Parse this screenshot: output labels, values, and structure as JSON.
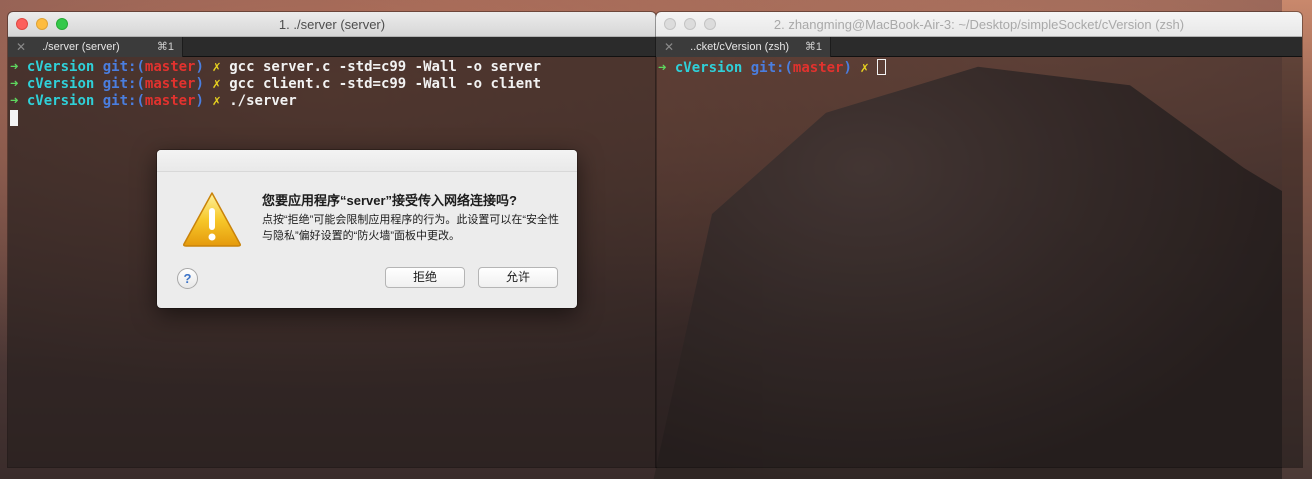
{
  "left_window": {
    "title": "1. ./server (server)",
    "tab_label": "./server (server)",
    "tab_shortcut": "⌘1",
    "lines": [
      {
        "arrow": "➜",
        "dir": "cVersion",
        "git": "git:",
        "open": "(",
        "branch": "master",
        "close": ")",
        "x": "✗",
        "cmd": "gcc server.c -std=c99 -Wall -o server"
      },
      {
        "arrow": "➜",
        "dir": "cVersion",
        "git": "git:",
        "open": "(",
        "branch": "master",
        "close": ")",
        "x": "✗",
        "cmd": "gcc client.c -std=c99 -Wall -o client"
      },
      {
        "arrow": "➜",
        "dir": "cVersion",
        "git": "git:",
        "open": "(",
        "branch": "master",
        "close": ")",
        "x": "✗",
        "cmd": "./server"
      }
    ]
  },
  "right_window": {
    "title": "2. zhangming@MacBook-Air-3: ~/Desktop/simpleSocket/cVersion (zsh)",
    "tab_label": "..cket/cVersion (zsh)",
    "tab_shortcut": "⌘1",
    "prompt": {
      "arrow": "➜",
      "dir": "cVersion",
      "git": "git:",
      "open": "(",
      "branch": "master",
      "close": ")",
      "x": "✗"
    }
  },
  "dialog": {
    "title": "您要应用程序“server”接受传入网络连接吗?",
    "message": "点按“拒绝”可能会限制应用程序的行为。此设置可以在“安全性与隐私”偏好设置的“防火墙”面板中更改。",
    "help_label": "?",
    "deny_label": "拒绝",
    "allow_label": "允许"
  },
  "colors": {
    "arrow": "#5fd75f",
    "dir": "#2fd0d8",
    "git": "#4a7ee0",
    "branch": "#e2322e",
    "x": "#e8d21f"
  },
  "icons": {
    "warning": "warning-triangle-icon",
    "close_tab": "close-icon",
    "help": "help-icon"
  }
}
